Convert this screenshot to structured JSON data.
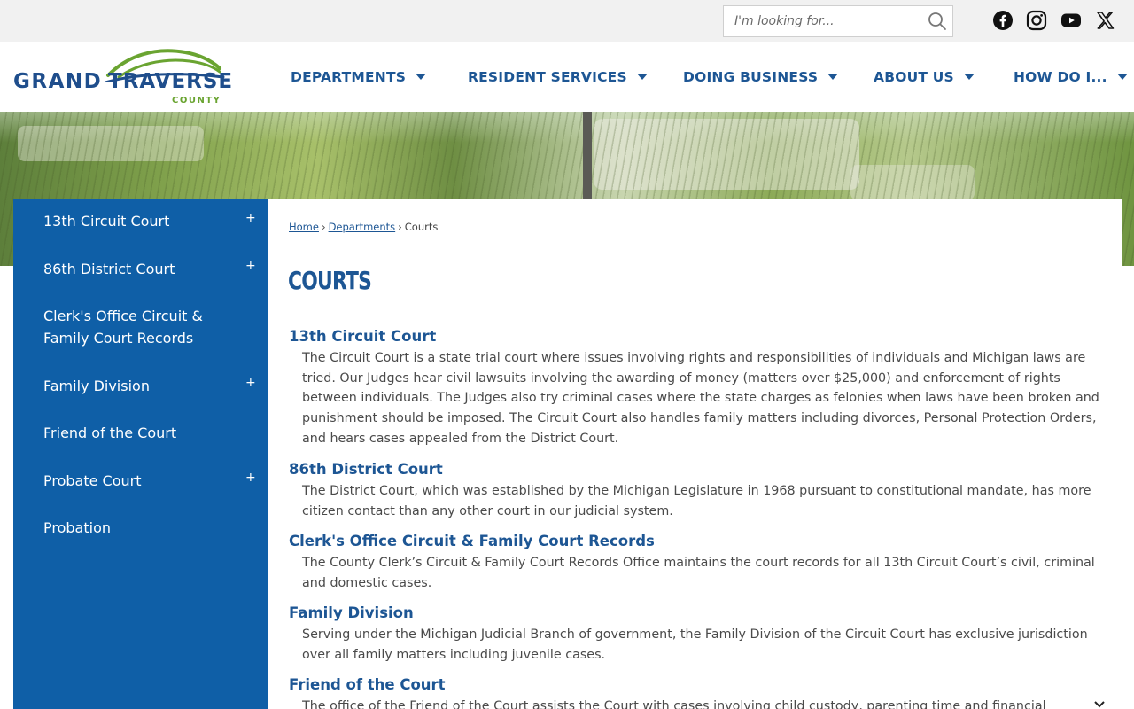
{
  "search": {
    "placeholder": "I'm looking for...",
    "value": ""
  },
  "social": [
    "facebook-icon",
    "instagram-icon",
    "youtube-icon",
    "x-icon"
  ],
  "logo": {
    "line1": "GRAND",
    "line2": "TRAVERSE",
    "line3": "COUNTY"
  },
  "nav": [
    {
      "label": "DEPARTMENTS"
    },
    {
      "label": "RESIDENT SERVICES"
    },
    {
      "label": "DOING BUSINESS"
    },
    {
      "label": "ABOUT US"
    },
    {
      "label": "HOW DO I..."
    }
  ],
  "sidebar": {
    "items": [
      {
        "label": "13th Circuit Court",
        "expand": "+"
      },
      {
        "label": "86th District Court",
        "expand": "+"
      },
      {
        "label": "Clerk's Office Circuit & Family Court Records",
        "expand": ""
      },
      {
        "label": "Family Division",
        "expand": "+"
      },
      {
        "label": "Friend of the Court",
        "expand": ""
      },
      {
        "label": "Probate Court",
        "expand": "+"
      },
      {
        "label": "Probation",
        "expand": ""
      }
    ]
  },
  "breadcrumb": {
    "home": "Home",
    "departments": "Departments",
    "current": "Courts",
    "separator": "›"
  },
  "page": {
    "title": "COURTS"
  },
  "sections": [
    {
      "title": "13th Circuit Court",
      "desc": "The Circuit Court is a state trial court where issues involving rights and responsibilities of individuals and Michigan laws are tried. Our Judges hear civil lawsuits involving the awarding of money (matters over $25,000) and enforcement of rights between individuals. The Judges also try criminal cases where the state charges as felonies when laws have been broken and punishment should be imposed. The Circuit Court also handles family matters including divorces, Personal Protection Orders, and hears cases appealed from the District Court."
    },
    {
      "title": "86th District Court",
      "desc": "The District Court, which was established by the Michigan Legislature in 1968 pursuant to constitutional mandate, has more citizen contact than any other court in our judicial system."
    },
    {
      "title": "Clerk's Office Circuit & Family Court Records",
      "desc": "The County Clerk’s Circuit & Family Court Records Office maintains the court records for all 13th Circuit Court’s civil, criminal and domestic cases."
    },
    {
      "title": "Family Division",
      "desc": "Serving under the Michigan Judicial Branch of government, the Family Division of the Circuit Court has exclusive jurisdiction over all family matters including juvenile cases."
    },
    {
      "title": "Friend of the Court",
      "desc": "The office of the Friend of the Court assists the Court with cases involving child custody, parenting time and financial"
    }
  ],
  "colors": {
    "brand_blue": "#1d5694",
    "sidebar_blue": "#0f5fa7",
    "brand_green": "#6aa431",
    "topbar": "#f1f1f1"
  }
}
